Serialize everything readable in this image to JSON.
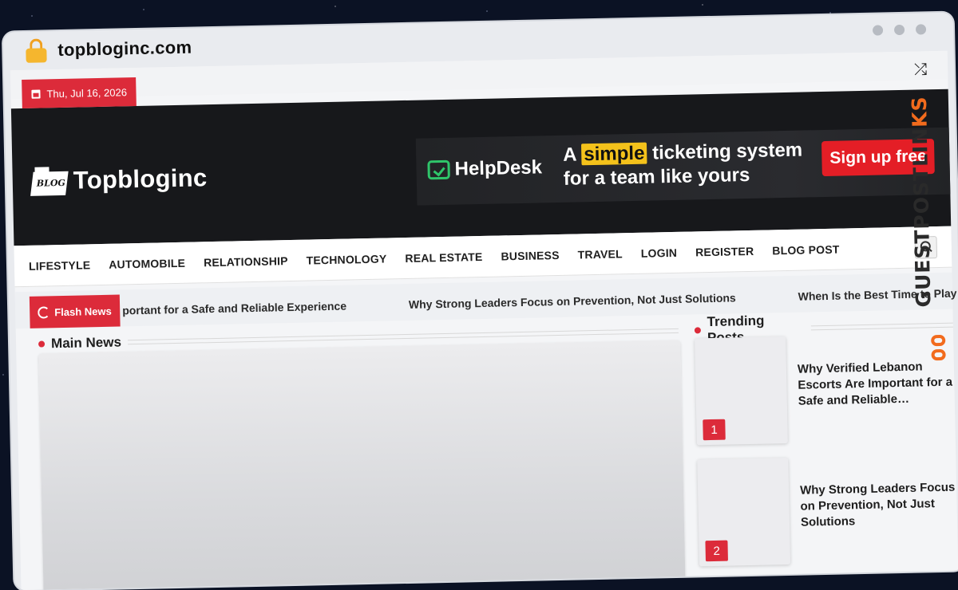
{
  "browser": {
    "url": "topbloginc.com"
  },
  "topbar": {
    "date": "Thu, Jul 16, 2026"
  },
  "brand": {
    "logo_badge": "BLOG",
    "name": "Topbloginc"
  },
  "ad": {
    "brand": "HelpDesk",
    "line1_pre": "A",
    "line1_highlight": "simple",
    "line1_post": "ticketing system",
    "line2": "for a team like yours",
    "cta": "Sign up free",
    "colors": {
      "accent": "#2fc56a",
      "highlight": "#f4c21b",
      "cta": "#e41e26"
    }
  },
  "nav": {
    "items": [
      "LIFESTYLE",
      "AUTOMOBILE",
      "RELATIONSHIP",
      "TECHNOLOGY",
      "REAL ESTATE",
      "BUSINESS",
      "TRAVEL",
      "LOGIN",
      "REGISTER",
      "BLOG POST"
    ]
  },
  "flash": {
    "label": "Flash News",
    "items": [
      "portant for a Safe and Reliable Experience",
      "Why Strong Leaders Focus on Prevention, Not Just Solutions",
      "When Is the Best Time to Play Slot M"
    ]
  },
  "main_news": {
    "title": "Main News"
  },
  "trending": {
    "title": "Trending Posts",
    "items": [
      {
        "rank": "1",
        "title": "Why Verified Lebanon Escorts Are Important for a Safe and Reliable…"
      },
      {
        "rank": "2",
        "title": "Why Strong Leaders Focus on Prevention, Not Just Solutions"
      }
    ]
  },
  "watermark": {
    "text_main": "GUESTPOSTLIN",
    "text_accent": "KS"
  },
  "colors": {
    "brand_red": "#dc2b3a",
    "header_bg": "#17181b"
  }
}
